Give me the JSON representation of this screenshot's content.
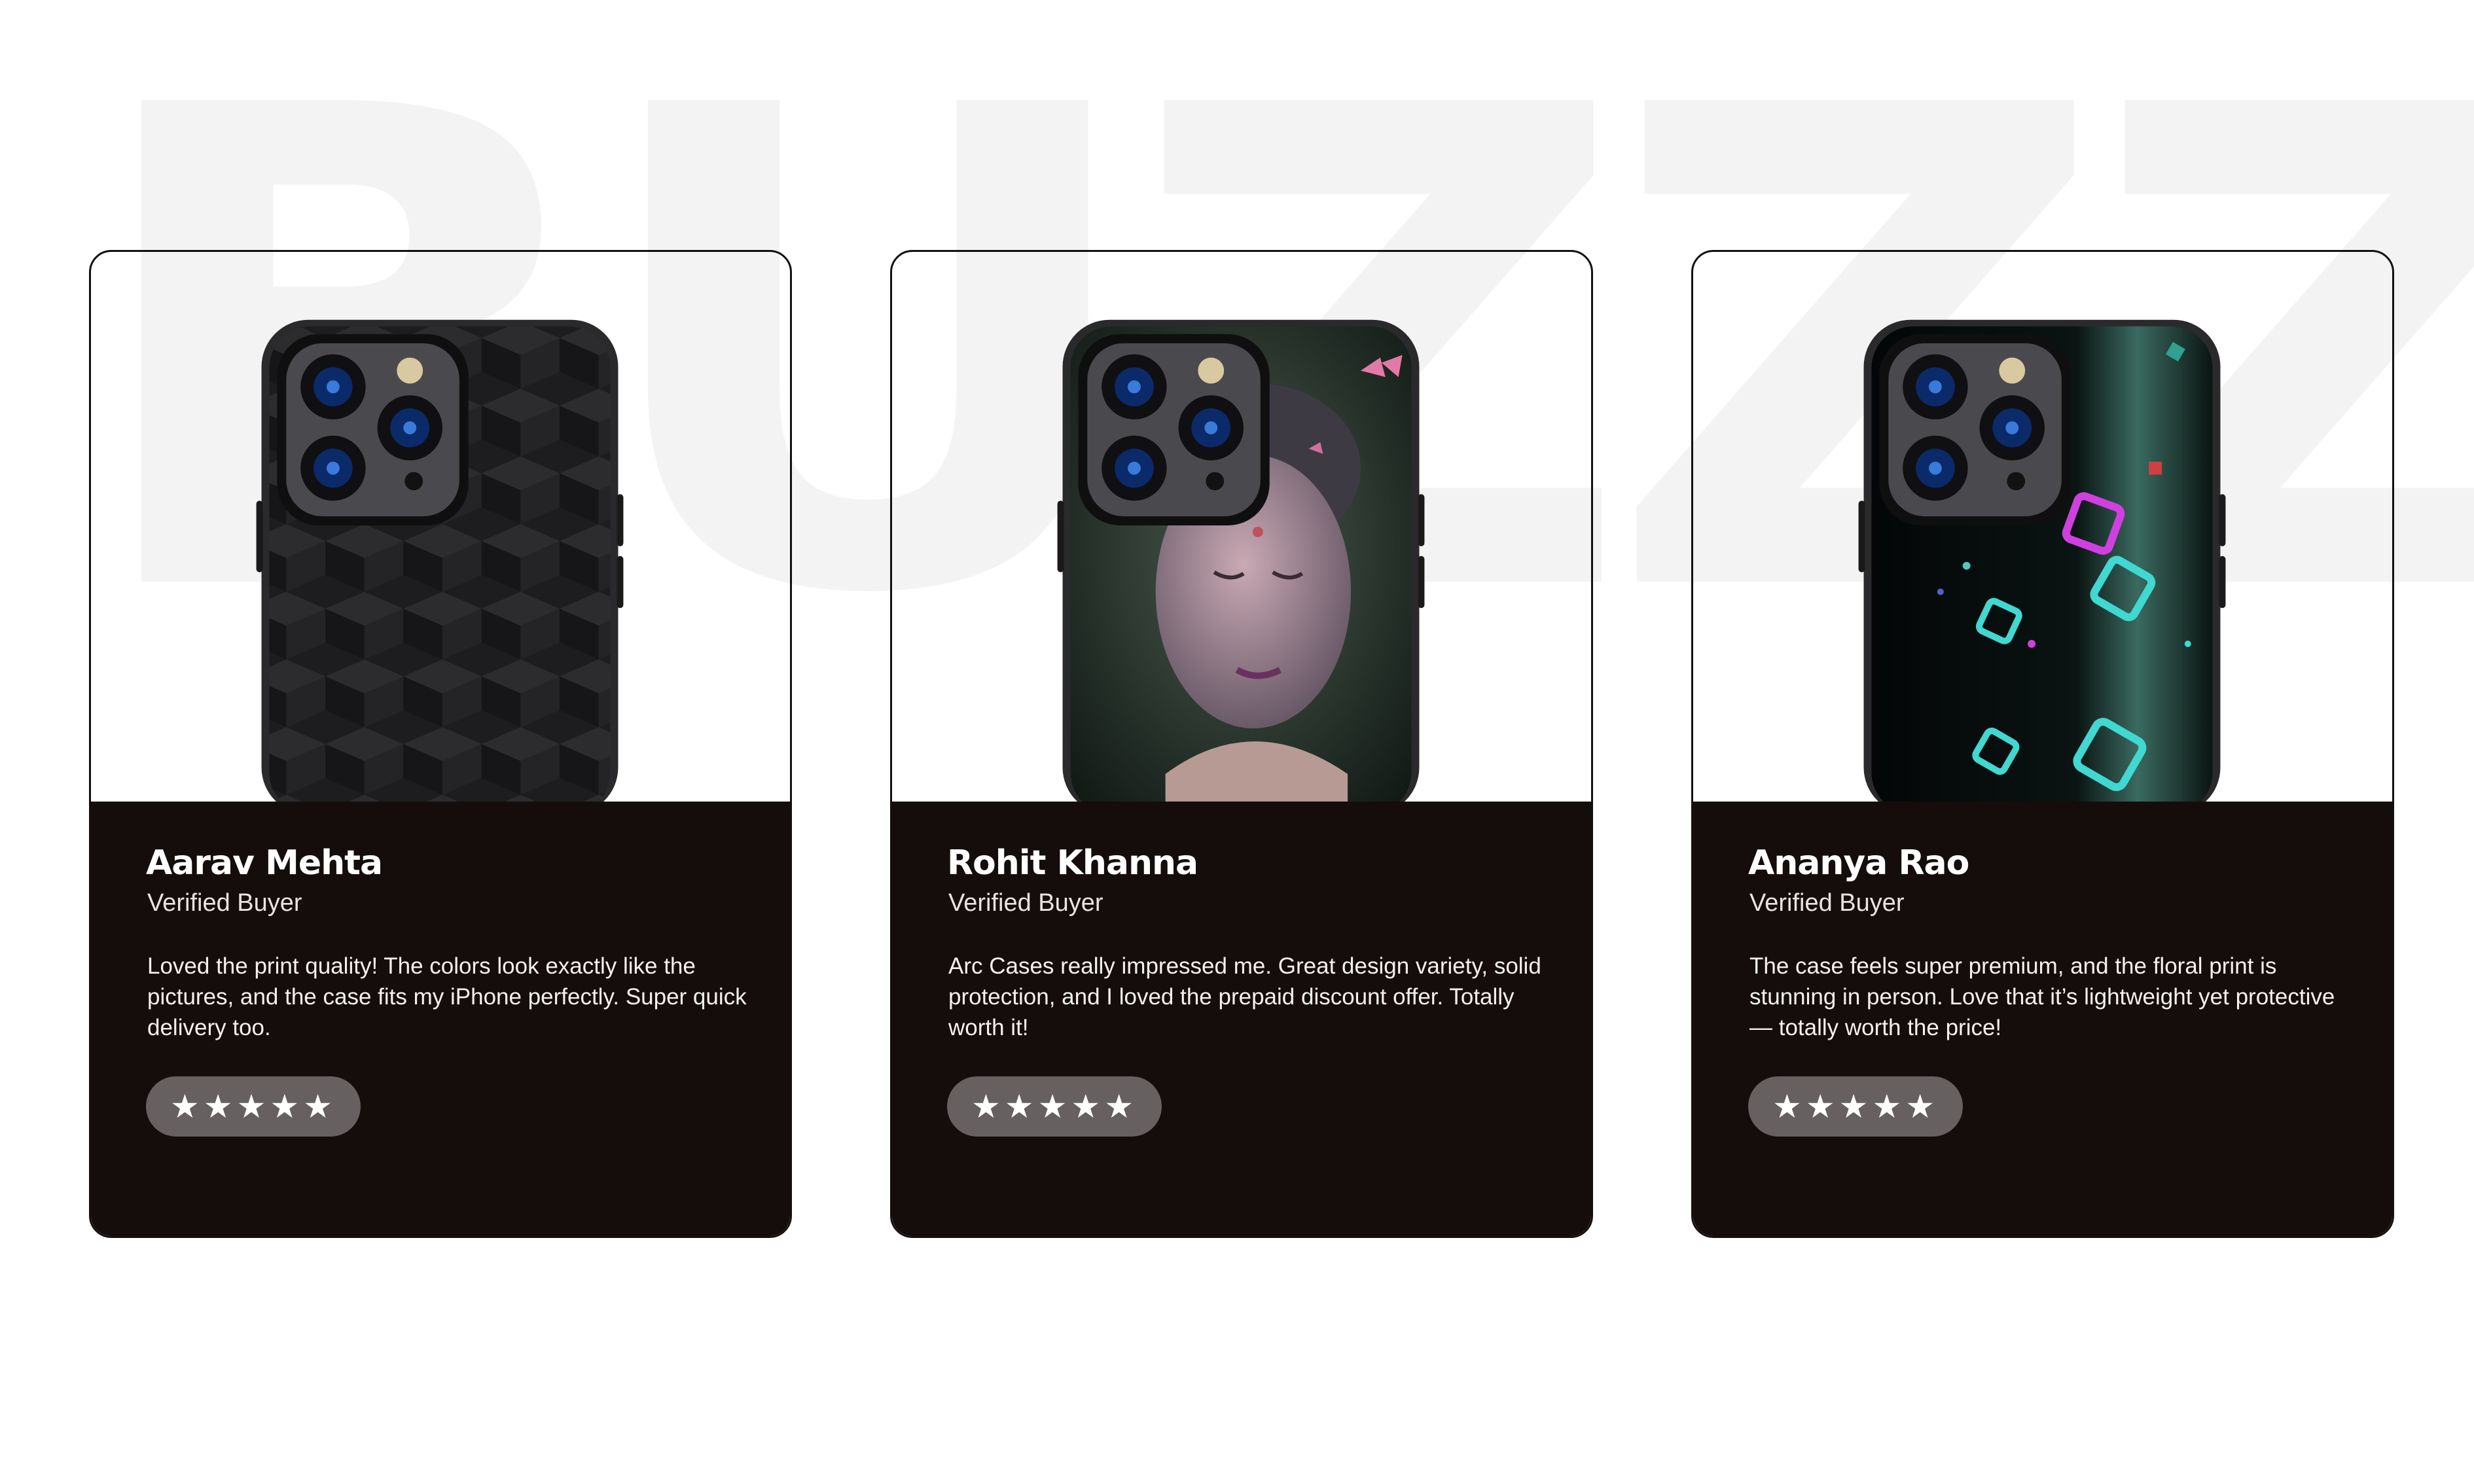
{
  "background_word": "BUZZZ",
  "colors": {
    "card_dark": "#140d0c",
    "rating_pill": "#666060",
    "watermark": "#f3f3f3"
  },
  "reviews": [
    {
      "name": "Aarav Mehta",
      "role": "Verified Buyer",
      "text": "Loved the print quality! The colors look exactly like the pictures, and the case fits my iPhone perfectly. Super quick delivery too.",
      "stars": "★★★★★",
      "case_design": "dark-geometric-cube-pattern"
    },
    {
      "name": "Rohit Khanna",
      "role": "Verified Buyer",
      "text": "Arc Cases really impressed me. Great design variety, solid protection, and I loved the prepaid discount offer. Totally worth it!",
      "stars": "★★★★★",
      "case_design": "buddha-face-with-butterflies"
    },
    {
      "name": "Ananya Rao",
      "role": "Verified Buyer",
      "text": "The case feels super premium, and the floral print is stunning in person. Love that it’s lightweight yet protective — totally worth the price!",
      "stars": "★★★★★",
      "case_design": "neon-floating-cubes"
    }
  ]
}
